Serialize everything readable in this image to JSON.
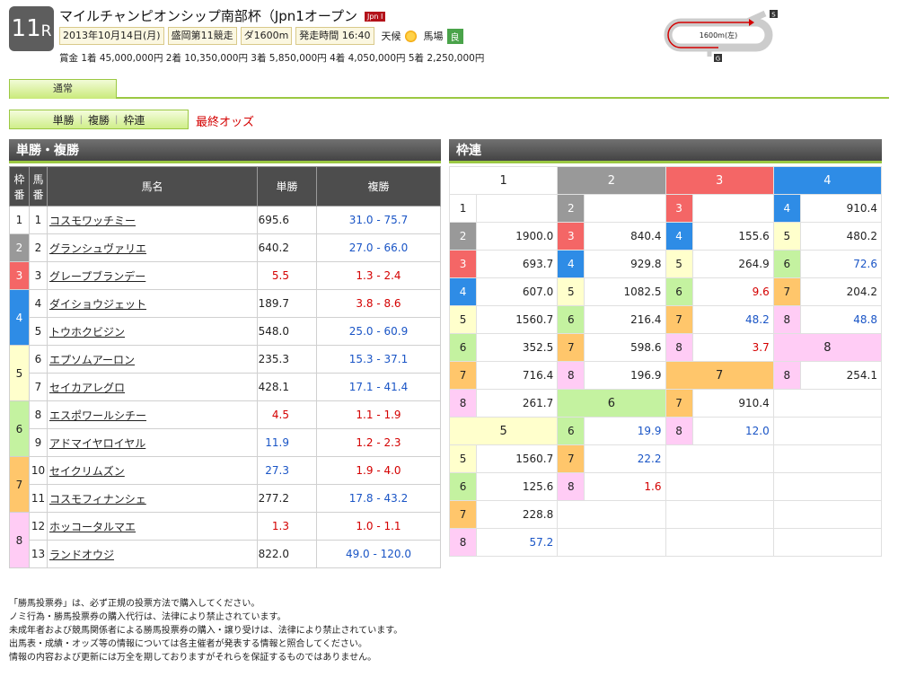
{
  "race": {
    "number": "11",
    "suffix": "R",
    "title": "マイルチャンピオンシップ南部杯（Jpn1オープン",
    "grade": "Jpn I",
    "date": "2013年10月14日(月)",
    "venue": "盛岡第11競走",
    "distance": "ダ1600m",
    "start_time": "発走時間 16:40",
    "weather_label": "天候",
    "track_label": "馬場",
    "track_condition": "良",
    "prize": "賞金 1着 45,000,000円 2着 10,350,000円 3着 5,850,000円 4着 4,050,000円 5着 2,250,000円",
    "course_label": "1600m(左)",
    "course_start": "S",
    "course_goal": "G"
  },
  "tabs": {
    "active": "通常"
  },
  "bet_buttons": {
    "win": "単勝",
    "place": "複勝",
    "bracket": "枠連",
    "separator": "|"
  },
  "final_odds_label": "最終オッズ",
  "left_panel": {
    "title": "単勝・複勝",
    "headers": {
      "waku": "枠番",
      "uma": "馬番",
      "name": "馬名",
      "win": "単勝",
      "place": "複勝"
    }
  },
  "horses": [
    {
      "waku": "1",
      "uma": "1",
      "name": "コスモワッチミー",
      "win": "695.6",
      "place_lo": "31.0",
      "place_hi": "75.7",
      "win_color": "none",
      "place_color": "blue"
    },
    {
      "waku": "2",
      "uma": "2",
      "name": "グランシュヴァリエ",
      "win": "640.2",
      "place_lo": "27.0",
      "place_hi": "66.0",
      "win_color": "none",
      "place_color": "blue"
    },
    {
      "waku": "3",
      "uma": "3",
      "name": "グレープブランデー",
      "win": "5.5",
      "place_lo": "1.3",
      "place_hi": "2.4",
      "win_color": "red",
      "place_color": "red"
    },
    {
      "waku": "4",
      "uma": "4",
      "name": "ダイショウジェット",
      "win": "189.7",
      "place_lo": "3.8",
      "place_hi": "8.6",
      "win_color": "none",
      "place_color": "red"
    },
    {
      "waku": "4",
      "uma": "5",
      "name": "トウホクビジン",
      "win": "548.0",
      "place_lo": "25.0",
      "place_hi": "60.9",
      "win_color": "none",
      "place_color": "blue"
    },
    {
      "waku": "5",
      "uma": "6",
      "name": "エプソムアーロン",
      "win": "235.3",
      "place_lo": "15.3",
      "place_hi": "37.1",
      "win_color": "none",
      "place_color": "blue"
    },
    {
      "waku": "5",
      "uma": "7",
      "name": "セイカアレグロ",
      "win": "428.1",
      "place_lo": "17.1",
      "place_hi": "41.4",
      "win_color": "none",
      "place_color": "blue"
    },
    {
      "waku": "6",
      "uma": "8",
      "name": "エスポワールシチー",
      "win": "4.5",
      "place_lo": "1.1",
      "place_hi": "1.9",
      "win_color": "red",
      "place_color": "red"
    },
    {
      "waku": "6",
      "uma": "9",
      "name": "アドマイヤロイヤル",
      "win": "11.9",
      "place_lo": "1.2",
      "place_hi": "2.3",
      "win_color": "blue",
      "place_color": "red"
    },
    {
      "waku": "7",
      "uma": "10",
      "name": "セイクリムズン",
      "win": "27.3",
      "place_lo": "1.9",
      "place_hi": "4.0",
      "win_color": "blue",
      "place_color": "red"
    },
    {
      "waku": "7",
      "uma": "11",
      "name": "コスモフィナンシェ",
      "win": "277.2",
      "place_lo": "17.8",
      "place_hi": "43.2",
      "win_color": "none",
      "place_color": "blue"
    },
    {
      "waku": "8",
      "uma": "12",
      "name": "ホッコータルマエ",
      "win": "1.3",
      "place_lo": "1.0",
      "place_hi": "1.1",
      "win_color": "red",
      "place_color": "red"
    },
    {
      "waku": "8",
      "uma": "13",
      "name": "ランドオウジ",
      "win": "822.0",
      "place_lo": "49.0",
      "place_hi": "120.0",
      "win_color": "none",
      "place_color": "blue"
    }
  ],
  "right_panel": {
    "title": "枠連",
    "col_heads": [
      "1",
      "2",
      "3",
      "4"
    ],
    "blocks": [
      {
        "head": "1",
        "rows": [
          {
            "n": "1",
            "v": "",
            "c": "none"
          },
          {
            "n": "2",
            "v": "1900.0",
            "c": "none"
          },
          {
            "n": "3",
            "v": "693.7",
            "c": "none"
          },
          {
            "n": "4",
            "v": "607.0",
            "c": "none"
          },
          {
            "n": "5",
            "v": "1560.7",
            "c": "none"
          },
          {
            "n": "6",
            "v": "352.5",
            "c": "none"
          },
          {
            "n": "7",
            "v": "716.4",
            "c": "none"
          },
          {
            "n": "8",
            "v": "261.7",
            "c": "none"
          }
        ]
      },
      {
        "head": "2",
        "rows": [
          {
            "n": "2",
            "v": "",
            "c": "none"
          },
          {
            "n": "3",
            "v": "840.4",
            "c": "none"
          },
          {
            "n": "4",
            "v": "929.8",
            "c": "none"
          },
          {
            "n": "5",
            "v": "1082.5",
            "c": "none"
          },
          {
            "n": "6",
            "v": "216.4",
            "c": "none"
          },
          {
            "n": "7",
            "v": "598.6",
            "c": "none"
          },
          {
            "n": "8",
            "v": "196.9",
            "c": "none"
          }
        ]
      },
      {
        "head": "3",
        "rows": [
          {
            "n": "3",
            "v": "",
            "c": "none"
          },
          {
            "n": "4",
            "v": "155.6",
            "c": "none"
          },
          {
            "n": "5",
            "v": "264.9",
            "c": "none"
          },
          {
            "n": "6",
            "v": "9.6",
            "c": "red"
          },
          {
            "n": "7",
            "v": "48.2",
            "c": "blue"
          },
          {
            "n": "8",
            "v": "3.7",
            "c": "red"
          }
        ]
      },
      {
        "head": "4",
        "rows": [
          {
            "n": "4",
            "v": "910.4",
            "c": "none"
          },
          {
            "n": "5",
            "v": "480.2",
            "c": "none"
          },
          {
            "n": "6",
            "v": "72.6",
            "c": "blue"
          },
          {
            "n": "7",
            "v": "204.2",
            "c": "none"
          },
          {
            "n": "8",
            "v": "48.8",
            "c": "blue"
          }
        ]
      },
      {
        "head": "5",
        "rows": [
          {
            "n": "5",
            "v": "1560.7",
            "c": "none"
          },
          {
            "n": "6",
            "v": "125.6",
            "c": "none"
          },
          {
            "n": "7",
            "v": "228.8",
            "c": "none"
          },
          {
            "n": "8",
            "v": "57.2",
            "c": "blue"
          }
        ]
      },
      {
        "head": "6",
        "rows": [
          {
            "n": "6",
            "v": "19.9",
            "c": "blue"
          },
          {
            "n": "7",
            "v": "22.2",
            "c": "blue"
          },
          {
            "n": "8",
            "v": "1.6",
            "c": "red"
          }
        ]
      },
      {
        "head": "7",
        "rows": [
          {
            "n": "7",
            "v": "910.4",
            "c": "none"
          },
          {
            "n": "8",
            "v": "12.0",
            "c": "blue"
          }
        ]
      },
      {
        "head": "8",
        "rows": [
          {
            "n": "8",
            "v": "254.1",
            "c": "none"
          }
        ]
      }
    ]
  },
  "notes": [
    "「勝馬投票券」は、必ず正規の投票方法で購入してください。",
    "ノミ行為・勝馬投票券の購入代行は、法律により禁止されています。",
    "未成年者および競馬関係者による勝馬投票券の購入・譲り受けは、法律により禁止されています。",
    "出馬表・成績・オッズ等の情報については各主催者が発表する情報と照合してください。",
    "情報の内容および更新には万全を期しておりますがそれらを保証するものではありません。"
  ],
  "colors": {
    "accent_green": "#9bc842",
    "header_gray": "#4d4d4d",
    "red": "#d40000",
    "blue": "#1a55c6"
  }
}
